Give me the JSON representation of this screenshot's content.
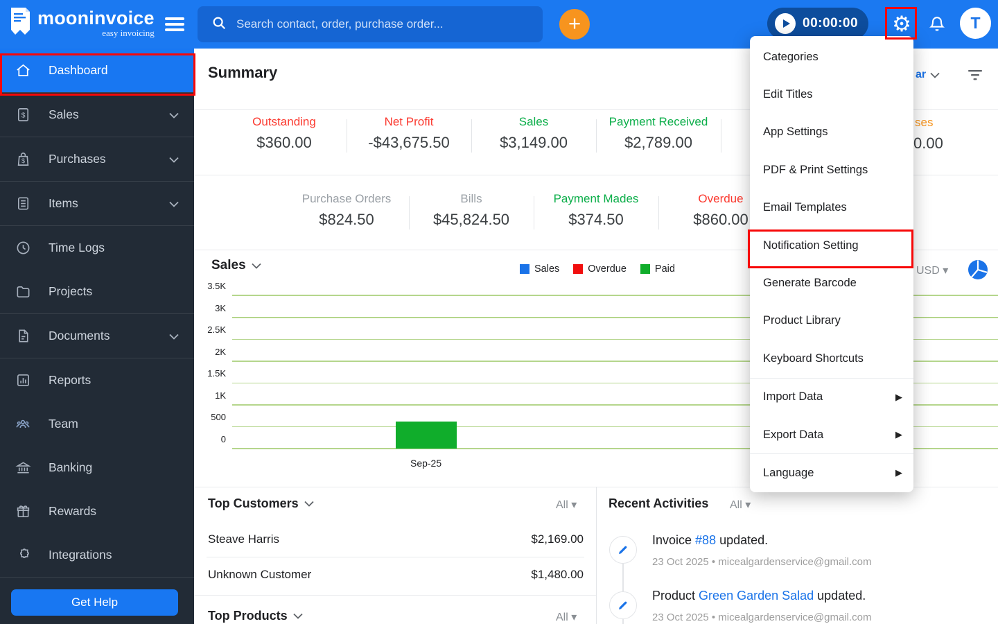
{
  "colors": {
    "topbar": "#1b79f1",
    "sidebar": "#222b36",
    "accent": "#1a73e8",
    "active_item": "#1877f2",
    "highlight_red": "#f70808",
    "plus_orange": "#f7941e",
    "timer_pill": "#0d4d9d",
    "money_red": "#fb3a30",
    "money_green": "#0cae4a",
    "money_gray": "#9aa0a6",
    "money_orange": "#f7941d",
    "gridline_green": "#b5d68c"
  },
  "topbar": {
    "brand": "mooninvoice",
    "tagline": "easy invoicing",
    "search_placeholder": "Search contact, order, purchase order...",
    "timer": "00:00:00",
    "avatar_initial": "T"
  },
  "sidebar": {
    "items": [
      {
        "label": "Dashboard",
        "active": true,
        "chevron": false
      },
      {
        "label": "Sales",
        "active": false,
        "chevron": true
      },
      {
        "label": "Purchases",
        "active": false,
        "chevron": true
      },
      {
        "label": "Items",
        "active": false,
        "chevron": true
      },
      {
        "label": "Time Logs",
        "active": false,
        "chevron": false
      },
      {
        "label": "Projects",
        "active": false,
        "chevron": false
      },
      {
        "label": "Documents",
        "active": false,
        "chevron": true
      },
      {
        "label": "Reports",
        "active": false,
        "chevron": false
      },
      {
        "label": "Team",
        "active": false,
        "chevron": false
      },
      {
        "label": "Banking",
        "active": false,
        "chevron": false
      },
      {
        "label": "Rewards",
        "active": false,
        "chevron": false
      },
      {
        "label": "Integrations",
        "active": false,
        "chevron": false
      }
    ],
    "get_help": "Get Help"
  },
  "summary": {
    "title": "Summary",
    "period_selector_visible_fragment": "ar",
    "row1": [
      {
        "label": "Outstanding",
        "value": "$360.00",
        "color": "#fb3a30"
      },
      {
        "label": "Net Profit",
        "value": "-$43,675.50",
        "color": "#fb3a30"
      },
      {
        "label": "Sales",
        "value": "$3,149.00",
        "color": "#0cae4a"
      },
      {
        "label": "Payment Received",
        "value": "$2,789.00",
        "color": "#0cae4a"
      }
    ],
    "row1_partial": {
      "label_fragment": "ses",
      "value_fragment": "0.00",
      "color": "#f7941d"
    },
    "row2": [
      {
        "label": "Purchase Orders",
        "value": "$824.50",
        "color": "#9aa0a6"
      },
      {
        "label": "Bills",
        "value": "$45,824.50",
        "color": "#9aa0a6"
      },
      {
        "label": "Payment Mades",
        "value": "$374.50",
        "color": "#0cae4a"
      },
      {
        "label": "Overdue",
        "value": "$860.00",
        "color": "#fb3a30"
      }
    ]
  },
  "chart_data": {
    "type": "bar",
    "title": "Sales",
    "currency": "USD",
    "categories": [
      "Sep-25"
    ],
    "category_x_fractions": [
      0.253
    ],
    "series": [
      {
        "name": "Sales",
        "values": [
          0
        ],
        "color": "#1a73e8"
      },
      {
        "name": "Overdue",
        "values": [
          0
        ],
        "color": "#f10e0e"
      },
      {
        "name": "Paid",
        "values": [
          620
        ],
        "color": "#10ad2b"
      }
    ],
    "ylim": [
      0,
      3500
    ],
    "yticks": [
      "0",
      "500",
      "1K",
      "1.5K",
      "2K",
      "2.5K",
      "3K",
      "3.5K"
    ],
    "grid": true,
    "legend_position": "top-right"
  },
  "top_customers": {
    "title": "Top Customers",
    "filter": "All",
    "rows": [
      {
        "name": "Steave Harris",
        "amount": "$2,169.00"
      },
      {
        "name": "Unknown Customer",
        "amount": "$1,480.00"
      }
    ]
  },
  "top_products": {
    "title": "Top Products",
    "filter": "All"
  },
  "recent_activities": {
    "title": "Recent Activities",
    "filter": "All",
    "items": [
      {
        "prefix": "Invoice ",
        "link": "#88",
        "suffix": " updated.",
        "meta": "23 Oct 2025 • micealgardenservice@gmail.com"
      },
      {
        "prefix": "Product ",
        "link": "Green Garden Salad",
        "suffix": " updated.",
        "meta": "23 Oct 2025 • micealgardenservice@gmail.com"
      }
    ]
  },
  "menu": {
    "items": [
      {
        "label": "Categories"
      },
      {
        "label": "Edit Titles"
      },
      {
        "label": "App Settings"
      },
      {
        "label": "PDF & Print Settings"
      },
      {
        "label": "Email Templates"
      },
      {
        "label": "Notification Setting",
        "highlighted": true
      },
      {
        "label": "Generate Barcode"
      },
      {
        "label": "Product Library"
      },
      {
        "label": "Keyboard Shortcuts"
      },
      {
        "label": "Import Data",
        "submenu": true
      },
      {
        "label": "Export Data",
        "submenu": true
      },
      {
        "label": "Language",
        "submenu": true
      }
    ]
  }
}
